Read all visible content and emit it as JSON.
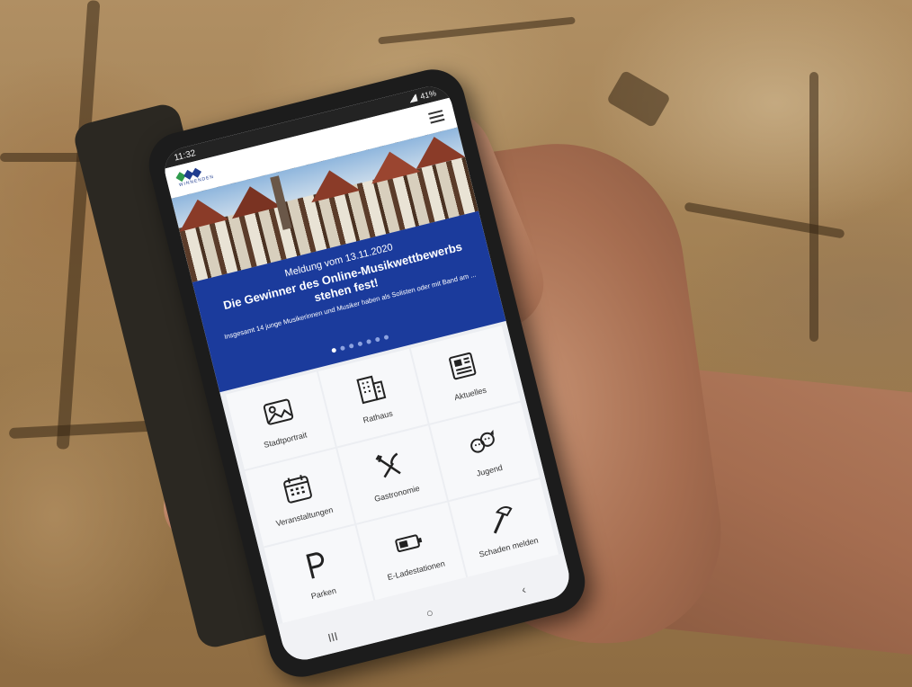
{
  "status_bar": {
    "time": "11:32",
    "battery": "41%"
  },
  "app": {
    "logo_text": "WINNENDEN"
  },
  "hero": {
    "date": "Meldung vom 13.11.2020",
    "title": "Die Gewinner des Online-Musikwettbewerbs stehen fest!",
    "teaser": "Insgesamt 14 junge Musikerinnen und Musiker haben als Solisten oder mit Band am ...",
    "slide_count": 7,
    "active_slide": 1
  },
  "tiles": [
    {
      "label": "Stadtportrait",
      "icon": "image-icon"
    },
    {
      "label": "Rathaus",
      "icon": "building-icon"
    },
    {
      "label": "Aktuelles",
      "icon": "newspaper-icon"
    },
    {
      "label": "Veranstaltungen",
      "icon": "calendar-icon"
    },
    {
      "label": "Gastronomie",
      "icon": "cutlery-icon"
    },
    {
      "label": "Jugend",
      "icon": "kids-icon"
    },
    {
      "label": "Parken",
      "icon": "parking-icon"
    },
    {
      "label": "E-Ladestationen",
      "icon": "battery-icon"
    },
    {
      "label": "Schaden melden",
      "icon": "hammer-icon"
    }
  ],
  "navbar": {
    "recents": "III",
    "home": "○",
    "back": "‹"
  },
  "colors": {
    "brand_blue": "#1b3b9c",
    "logo_green": "#2e9b4c"
  }
}
